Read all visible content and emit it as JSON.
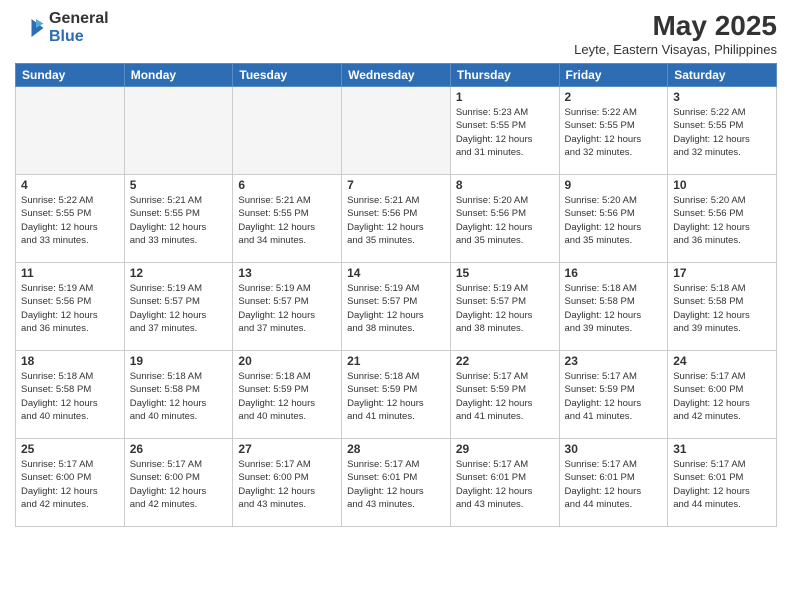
{
  "header": {
    "logo_general": "General",
    "logo_blue": "Blue",
    "month_title": "May 2025",
    "subtitle": "Leyte, Eastern Visayas, Philippines"
  },
  "weekdays": [
    "Sunday",
    "Monday",
    "Tuesday",
    "Wednesday",
    "Thursday",
    "Friday",
    "Saturday"
  ],
  "weeks": [
    [
      {
        "day": "",
        "info": ""
      },
      {
        "day": "",
        "info": ""
      },
      {
        "day": "",
        "info": ""
      },
      {
        "day": "",
        "info": ""
      },
      {
        "day": "1",
        "info": "Sunrise: 5:23 AM\nSunset: 5:55 PM\nDaylight: 12 hours\nand 31 minutes."
      },
      {
        "day": "2",
        "info": "Sunrise: 5:22 AM\nSunset: 5:55 PM\nDaylight: 12 hours\nand 32 minutes."
      },
      {
        "day": "3",
        "info": "Sunrise: 5:22 AM\nSunset: 5:55 PM\nDaylight: 12 hours\nand 32 minutes."
      }
    ],
    [
      {
        "day": "4",
        "info": "Sunrise: 5:22 AM\nSunset: 5:55 PM\nDaylight: 12 hours\nand 33 minutes."
      },
      {
        "day": "5",
        "info": "Sunrise: 5:21 AM\nSunset: 5:55 PM\nDaylight: 12 hours\nand 33 minutes."
      },
      {
        "day": "6",
        "info": "Sunrise: 5:21 AM\nSunset: 5:55 PM\nDaylight: 12 hours\nand 34 minutes."
      },
      {
        "day": "7",
        "info": "Sunrise: 5:21 AM\nSunset: 5:56 PM\nDaylight: 12 hours\nand 35 minutes."
      },
      {
        "day": "8",
        "info": "Sunrise: 5:20 AM\nSunset: 5:56 PM\nDaylight: 12 hours\nand 35 minutes."
      },
      {
        "day": "9",
        "info": "Sunrise: 5:20 AM\nSunset: 5:56 PM\nDaylight: 12 hours\nand 35 minutes."
      },
      {
        "day": "10",
        "info": "Sunrise: 5:20 AM\nSunset: 5:56 PM\nDaylight: 12 hours\nand 36 minutes."
      }
    ],
    [
      {
        "day": "11",
        "info": "Sunrise: 5:19 AM\nSunset: 5:56 PM\nDaylight: 12 hours\nand 36 minutes."
      },
      {
        "day": "12",
        "info": "Sunrise: 5:19 AM\nSunset: 5:57 PM\nDaylight: 12 hours\nand 37 minutes."
      },
      {
        "day": "13",
        "info": "Sunrise: 5:19 AM\nSunset: 5:57 PM\nDaylight: 12 hours\nand 37 minutes."
      },
      {
        "day": "14",
        "info": "Sunrise: 5:19 AM\nSunset: 5:57 PM\nDaylight: 12 hours\nand 38 minutes."
      },
      {
        "day": "15",
        "info": "Sunrise: 5:19 AM\nSunset: 5:57 PM\nDaylight: 12 hours\nand 38 minutes."
      },
      {
        "day": "16",
        "info": "Sunrise: 5:18 AM\nSunset: 5:58 PM\nDaylight: 12 hours\nand 39 minutes."
      },
      {
        "day": "17",
        "info": "Sunrise: 5:18 AM\nSunset: 5:58 PM\nDaylight: 12 hours\nand 39 minutes."
      }
    ],
    [
      {
        "day": "18",
        "info": "Sunrise: 5:18 AM\nSunset: 5:58 PM\nDaylight: 12 hours\nand 40 minutes."
      },
      {
        "day": "19",
        "info": "Sunrise: 5:18 AM\nSunset: 5:58 PM\nDaylight: 12 hours\nand 40 minutes."
      },
      {
        "day": "20",
        "info": "Sunrise: 5:18 AM\nSunset: 5:59 PM\nDaylight: 12 hours\nand 40 minutes."
      },
      {
        "day": "21",
        "info": "Sunrise: 5:18 AM\nSunset: 5:59 PM\nDaylight: 12 hours\nand 41 minutes."
      },
      {
        "day": "22",
        "info": "Sunrise: 5:17 AM\nSunset: 5:59 PM\nDaylight: 12 hours\nand 41 minutes."
      },
      {
        "day": "23",
        "info": "Sunrise: 5:17 AM\nSunset: 5:59 PM\nDaylight: 12 hours\nand 41 minutes."
      },
      {
        "day": "24",
        "info": "Sunrise: 5:17 AM\nSunset: 6:00 PM\nDaylight: 12 hours\nand 42 minutes."
      }
    ],
    [
      {
        "day": "25",
        "info": "Sunrise: 5:17 AM\nSunset: 6:00 PM\nDaylight: 12 hours\nand 42 minutes."
      },
      {
        "day": "26",
        "info": "Sunrise: 5:17 AM\nSunset: 6:00 PM\nDaylight: 12 hours\nand 42 minutes."
      },
      {
        "day": "27",
        "info": "Sunrise: 5:17 AM\nSunset: 6:00 PM\nDaylight: 12 hours\nand 43 minutes."
      },
      {
        "day": "28",
        "info": "Sunrise: 5:17 AM\nSunset: 6:01 PM\nDaylight: 12 hours\nand 43 minutes."
      },
      {
        "day": "29",
        "info": "Sunrise: 5:17 AM\nSunset: 6:01 PM\nDaylight: 12 hours\nand 43 minutes."
      },
      {
        "day": "30",
        "info": "Sunrise: 5:17 AM\nSunset: 6:01 PM\nDaylight: 12 hours\nand 44 minutes."
      },
      {
        "day": "31",
        "info": "Sunrise: 5:17 AM\nSunset: 6:01 PM\nDaylight: 12 hours\nand 44 minutes."
      }
    ]
  ]
}
